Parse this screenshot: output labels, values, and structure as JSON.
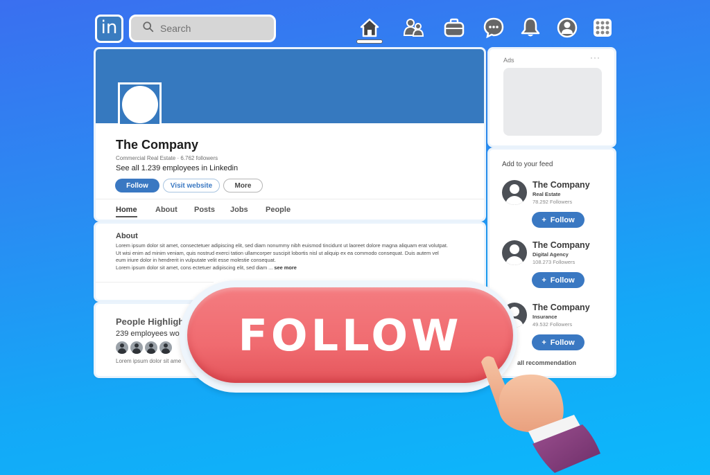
{
  "topbar": {
    "logo_text": "in",
    "search_placeholder": "Search",
    "nav_icons": [
      "home-icon",
      "network-icon",
      "jobs-icon",
      "messaging-icon",
      "notifications-icon",
      "profile-icon",
      "apps-grid-icon"
    ],
    "active_nav": "home-icon"
  },
  "profile": {
    "company_name": "The Company",
    "meta": "Commercial Real Estate · 6.762 followers",
    "employees_link": "See all 1.239 employees in Linkedin",
    "buttons": {
      "follow": "Follow",
      "visit_website": "Visit website",
      "more": "More"
    },
    "tabs": [
      {
        "label": "Home",
        "active": true
      },
      {
        "label": "About",
        "active": false
      },
      {
        "label": "Posts",
        "active": false
      },
      {
        "label": "Jobs",
        "active": false
      },
      {
        "label": "People",
        "active": false
      }
    ],
    "brand_color": "#3679bf"
  },
  "about": {
    "title": "About",
    "text": "Lorem ipsum dolor sit amet, consectetuer adipiscing elit, sed diam nonummy nibh euismod tincidunt ut laoreet dolore magna aliquam erat volutpat. Ut wisi enim ad minim veniam, quis nostrud exerci tation ullamcorper suscipit lobortis nisl ut aliquip ex ea commodo consequat. Duis autem vel eum iriure dolor in hendrerit in vulputate velit esse molestie consequat.",
    "text2": "Lorem ipsum dolor sit amet, cons ectetuer adipiscing elit, sed diam ... ",
    "see_more": "see more"
  },
  "people": {
    "title": "People Highlight",
    "subtitle": "239 employees work",
    "footer": "Lorem ipsum dolor sit ame"
  },
  "ads": {
    "label": "Ads",
    "menu": "···"
  },
  "feed": {
    "title": "Add to your feed",
    "recommendations": [
      {
        "name": "The Company",
        "type": "Real Estate",
        "followers": "78.292 Followers",
        "button": "Follow"
      },
      {
        "name": "The Company",
        "type": "Digital Agency",
        "followers": "108.273 Followers",
        "button": "Follow"
      },
      {
        "name": "The Company",
        "type": "Insurance",
        "followers": "49.532 Followers",
        "button": "Follow"
      }
    ],
    "view_all": "all recommendation"
  },
  "overlay": {
    "big_button_label": "FOLLOW",
    "button_color": "#f06b70"
  }
}
